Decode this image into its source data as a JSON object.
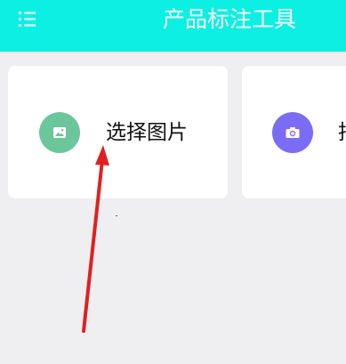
{
  "header": {
    "title": "产品标注工具",
    "background": "#0cf0e3",
    "menu_icon": "list-menu-icon"
  },
  "cards": [
    {
      "label": "选择图片",
      "icon": "image-icon",
      "icon_color": "#6cc69b"
    },
    {
      "label": "拍",
      "icon": "camera-icon",
      "icon_color": "#7b6cf6"
    }
  ],
  "annotation": {
    "type": "arrow",
    "color": "#e02020",
    "points_to": "选择图片"
  }
}
